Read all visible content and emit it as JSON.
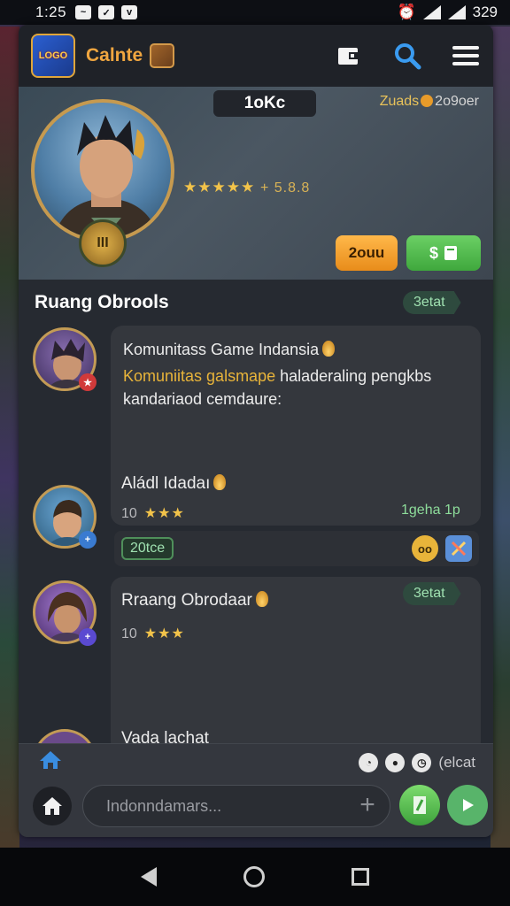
{
  "status_bar": {
    "time": "1:25",
    "battery": "329"
  },
  "app": {
    "logo_text": "LOGO",
    "name": "Calnte"
  },
  "hero": {
    "title": "1oKc",
    "rating_stars": "★★★★★",
    "rating_value": "+ 5.8.8",
    "corner_label": "Zuads",
    "corner_value": "2o9oer",
    "medal_text": "III",
    "gold_button": "2ouu",
    "green_button": "$"
  },
  "chat": {
    "title": "Ruang Obrools",
    "tag": "3etat",
    "messages": [
      {
        "title": "Komunitass Game Indansia",
        "highlight": "Komuniitas galsmape",
        "body_rest": " haladeraling pengkbs kandariaod cemdaure:",
        "sender": "Aládl Idadaı",
        "count": "10",
        "stars": "★★★",
        "time": "1geha 1p",
        "strip_tag": "20tce",
        "strip_icon_a": "oo"
      },
      {
        "title": "Rraang Obrodaar",
        "count": "10",
        "stars": "★★★",
        "tag": "3etat",
        "next_title": "Vada lachat"
      }
    ]
  },
  "composer": {
    "placeholder": "Indonndamars...",
    "tools_label": "(elcat"
  },
  "colors": {
    "accent_orange": "#f0a640",
    "accent_green": "#58b46a",
    "highlight": "#e8b43a"
  }
}
